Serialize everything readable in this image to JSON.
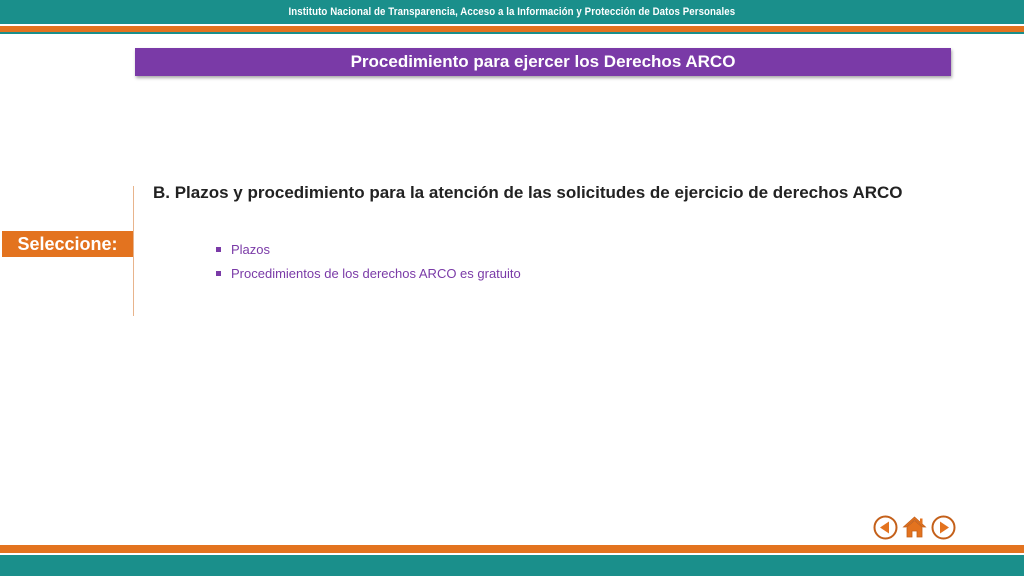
{
  "header": {
    "institution": "Instituto Nacional de Transparencia, Acceso a la Información y Protección de Datos Personales"
  },
  "banner": {
    "title": "Procedimiento para ejercer los Derechos ARCO"
  },
  "sidebar": {
    "select_label": "Seleccione:"
  },
  "content": {
    "heading": "B. Plazos y procedimiento para la atención de las solicitudes de ejercicio de derechos ARCO",
    "items": [
      {
        "label": "Plazos"
      },
      {
        "label": "Procedimientos de los derechos ARCO es gratuito"
      }
    ]
  },
  "navigation": {
    "back_icon": "arrow-left-circle-icon",
    "home_icon": "home-icon",
    "forward_icon": "arrow-right-circle-icon"
  },
  "colors": {
    "teal": "#1a8f8b",
    "orange": "#e3731f",
    "purple": "#7a3aa7"
  }
}
